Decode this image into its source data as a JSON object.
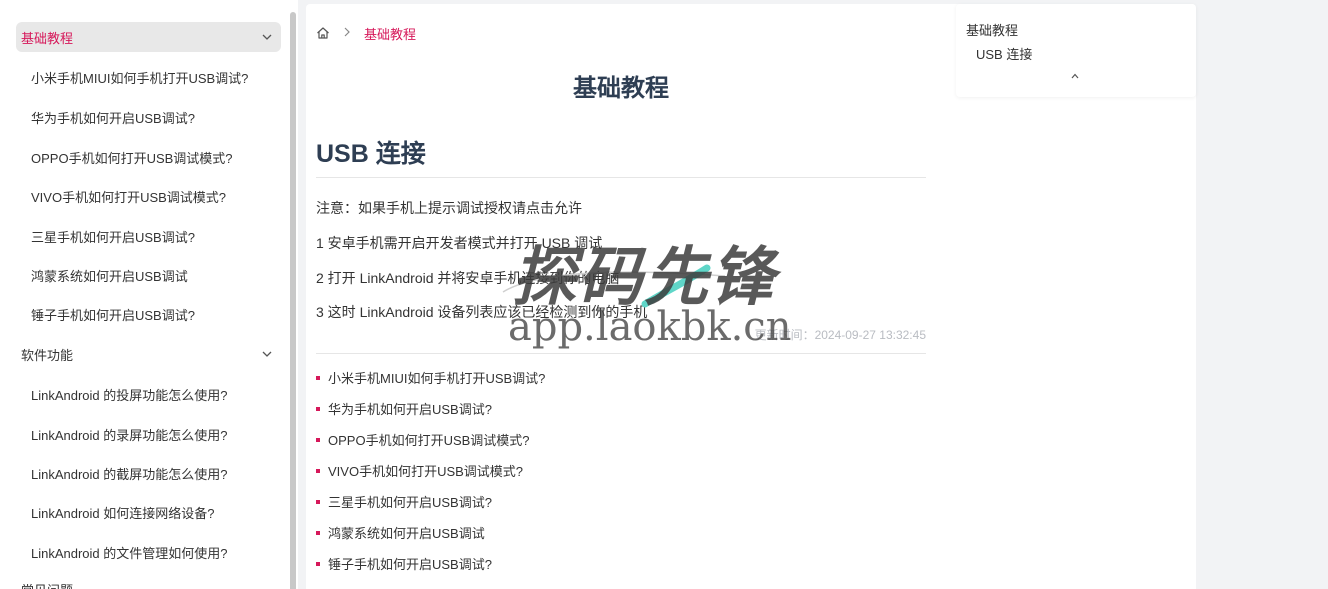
{
  "sidebar": {
    "groups": [
      {
        "label": "基础教程",
        "items": [
          "小米手机MIUI如何手机打开USB调试?",
          "华为手机如何开启USB调试?",
          "OPPO手机如何打开USB调试模式?",
          "VIVO手机如何打开USB调试模式?",
          "三星手机如何开启USB调试?",
          "鸿蒙系统如何开启USB调试",
          "锤子手机如何开启USB调试?"
        ]
      },
      {
        "label": "软件功能",
        "items": [
          "LinkAndroid 的投屏功能怎么使用?",
          "LinkAndroid 的录屏功能怎么使用?",
          "LinkAndroid 的截屏功能怎么使用?",
          "LinkAndroid 如何连接网络设备?",
          "LinkAndroid 的文件管理如何使用?"
        ]
      },
      {
        "label": "常见问题",
        "items": []
      }
    ]
  },
  "breadcrumb": {
    "home_icon": "home-icon",
    "current": "基础教程"
  },
  "article": {
    "page_title": "基础教程",
    "section_title": "USB 连接",
    "paragraphs": [
      "注意：如果手机上提示调试授权请点击允许",
      "1 安卓手机需开启开发者模式并打开 USB 调试",
      "2 打开 LinkAndroid 并将安卓手机连接到你的电脑",
      "3 这时 LinkAndroid 设备列表应该已经检测到你的手机"
    ],
    "updated": "更新时间：2024-09-27 13:32:45"
  },
  "related": [
    "小米手机MIUI如何手机打开USB调试?",
    "华为手机如何开启USB调试?",
    "OPPO手机如何打开USB调试模式?",
    "VIVO手机如何打开USB调试模式?",
    "三星手机如何开启USB调试?",
    "鸿蒙系统如何开启USB调试",
    "锤子手机如何开启USB调试?"
  ],
  "toc": {
    "title": "基础教程",
    "items": [
      "USB 连接"
    ],
    "collapse_icon": "chevron-up-icon"
  },
  "watermark": {
    "logo_text": "探码先锋",
    "url": "app.laokbk.cn"
  },
  "colors": {
    "accent": "#d6185a",
    "heading": "#2e3e53",
    "muted": "#b9bcc2"
  }
}
